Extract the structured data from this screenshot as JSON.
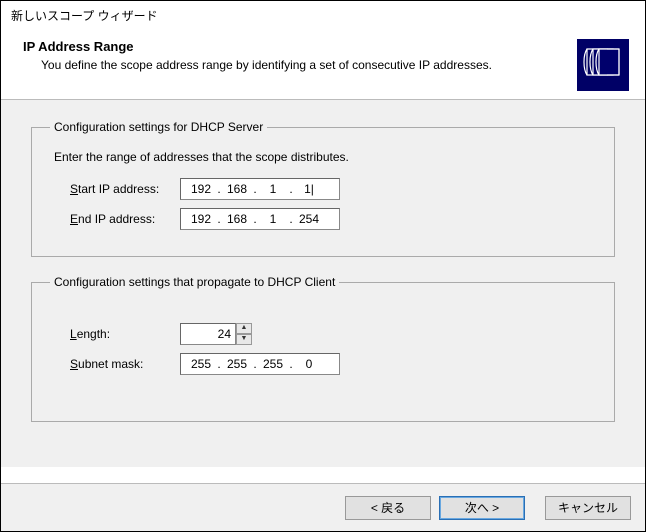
{
  "window": {
    "title": "新しいスコープ ウィザード"
  },
  "header": {
    "title": "IP Address Range",
    "subtitle": "You define the scope address range by identifying a set of consecutive IP addresses."
  },
  "group1": {
    "legend": "Configuration settings for DHCP Server",
    "instruction": "Enter the range of addresses that the scope distributes.",
    "start_label_pre": "S",
    "start_label_rest": "tart IP address:",
    "start_ip": {
      "o1": "192",
      "o2": "168",
      "o3": "1",
      "o4": "1"
    },
    "end_label_pre": "E",
    "end_label_rest": "nd IP address:",
    "end_ip": {
      "o1": "192",
      "o2": "168",
      "o3": "1",
      "o4": "254"
    }
  },
  "group2": {
    "legend": "Configuration settings that propagate to DHCP Client",
    "length_label_pre": "L",
    "length_label_rest": "ength:",
    "length_value": "24",
    "mask_label_pre": "S",
    "mask_label_rest": "ubnet mask:",
    "mask": {
      "o1": "255",
      "o2": "255",
      "o3": "255",
      "o4": "0"
    }
  },
  "footer": {
    "back_pre": "< 戻る",
    "next": "次へ >",
    "cancel": "キャンセル"
  },
  "dot": "."
}
